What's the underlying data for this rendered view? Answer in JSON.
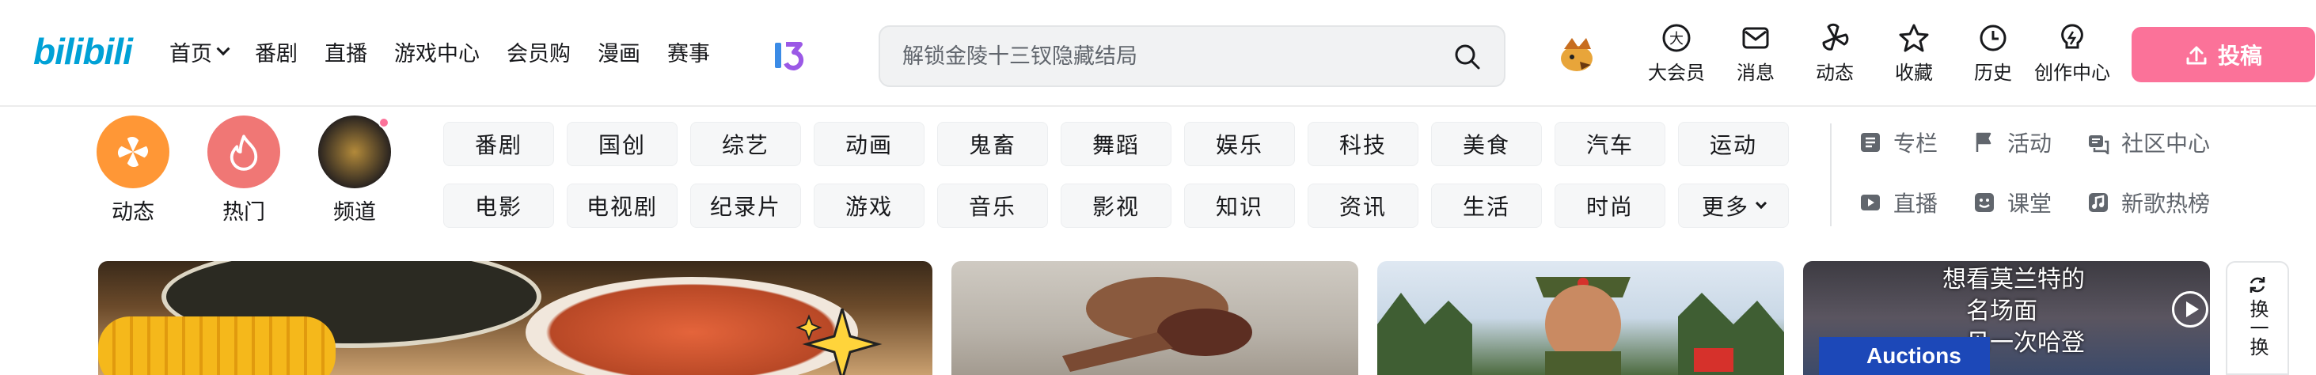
{
  "header": {
    "logo_text": "bilibili",
    "nav": [
      "首页",
      "番剧",
      "直播",
      "游戏中心",
      "会员购",
      "漫画",
      "赛事"
    ],
    "search_placeholder": "解锁金陵十三钗隐藏结局",
    "right_icons": [
      {
        "icon": "vip-icon",
        "label": "大会员"
      },
      {
        "icon": "message-icon",
        "label": "消息"
      },
      {
        "icon": "dynamic-icon",
        "label": "动态"
      },
      {
        "icon": "star-icon",
        "label": "收藏"
      },
      {
        "icon": "history-icon",
        "label": "历史"
      },
      {
        "icon": "bulb-icon",
        "label": "创作中心"
      }
    ],
    "upload_label": "投稿",
    "accent_color": "#fb7299",
    "brand_color": "#00a1d6"
  },
  "channels": [
    {
      "label": "动态",
      "color": "#ff9736"
    },
    {
      "label": "热门",
      "color": "#f07775"
    },
    {
      "label": "频道",
      "color": "#2a2420"
    }
  ],
  "tags": [
    "番剧",
    "国创",
    "综艺",
    "动画",
    "鬼畜",
    "舞蹈",
    "娱乐",
    "科技",
    "美食",
    "汽车",
    "运动",
    "电影",
    "电视剧",
    "纪录片",
    "游戏",
    "音乐",
    "影视",
    "知识",
    "资讯",
    "生活",
    "时尚",
    "更多"
  ],
  "links": [
    {
      "icon": "column-icon",
      "label": "专栏"
    },
    {
      "icon": "flag-icon",
      "label": "活动"
    },
    {
      "icon": "community-icon",
      "label": "社区中心"
    },
    {
      "icon": "live-icon",
      "label": "直播"
    },
    {
      "icon": "classroom-icon",
      "label": "课堂"
    },
    {
      "icon": "music-icon",
      "label": "新歌热榜"
    }
  ],
  "cards": {
    "card4_caption_1": "想看莫兰特的",
    "card4_caption_2": "名场面",
    "card4_caption_3": "见一次哈登",
    "card4_logo": "Auctions"
  },
  "refresh_label": "换一换"
}
